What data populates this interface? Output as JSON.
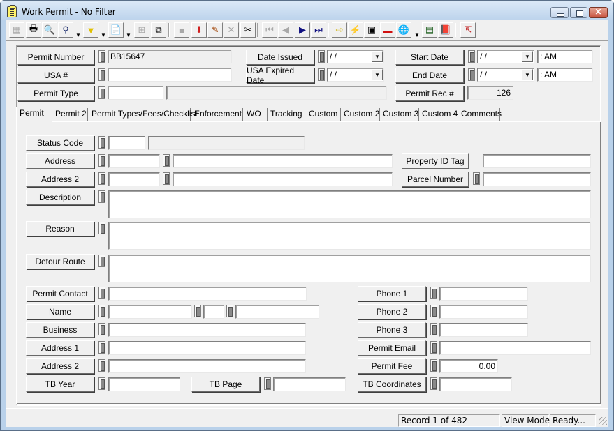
{
  "window": {
    "title": "Work Permit - No Filter"
  },
  "toolbar": {
    "buttons": [
      {
        "name": "form-view-icon",
        "glyph": "▦",
        "disabled": true
      },
      {
        "name": "print-icon",
        "glyph": "🖶"
      },
      {
        "name": "print-preview-icon",
        "glyph": "🔍"
      },
      {
        "name": "find-icon",
        "glyph": "⚲"
      },
      {
        "name": "filter-icon",
        "glyph": "▼"
      },
      {
        "name": "report-icon",
        "glyph": "📄"
      },
      {
        "name": "properties-icon",
        "glyph": "⊞",
        "disabled": true
      },
      {
        "name": "copy-record-icon",
        "glyph": "⧉"
      },
      {
        "name": "save-icon",
        "glyph": "■",
        "disabled": true
      },
      {
        "name": "import-icon",
        "glyph": "⬇"
      },
      {
        "name": "edit-icon",
        "glyph": "✎"
      },
      {
        "name": "delete-icon",
        "glyph": "✕",
        "disabled": true
      },
      {
        "name": "cut-icon",
        "glyph": "✂"
      },
      {
        "name": "first-record-icon",
        "glyph": "⏮",
        "disabled": true
      },
      {
        "name": "previous-record-icon",
        "glyph": "◀",
        "disabled": true
      },
      {
        "name": "next-record-icon",
        "glyph": "▶"
      },
      {
        "name": "last-record-icon",
        "glyph": "⏭"
      },
      {
        "name": "go-to-icon",
        "glyph": "⇨"
      },
      {
        "name": "quick-action-icon",
        "glyph": "⚡"
      },
      {
        "name": "workflow-icon",
        "glyph": "▣"
      },
      {
        "name": "toolbox-icon",
        "glyph": "▬"
      },
      {
        "name": "web-map-icon",
        "glyph": "🌐"
      },
      {
        "name": "calculator-icon",
        "glyph": "▤"
      },
      {
        "name": "help-book-icon",
        "glyph": "📕"
      },
      {
        "name": "exit-icon",
        "glyph": "⇱"
      }
    ]
  },
  "header": {
    "permit_number": {
      "label": "Permit Number",
      "value": "BB15647"
    },
    "usa_number": {
      "label": "USA #",
      "value": ""
    },
    "permit_type": {
      "label": "Permit Type",
      "code": "",
      "description": ""
    },
    "date_issued": {
      "label": "Date Issued",
      "value": " / /"
    },
    "usa_expired_date": {
      "label": "USA Expired Date",
      "value": " / /"
    },
    "start_date": {
      "label": "Start Date",
      "date": " / /",
      "time": "  :  AM"
    },
    "end_date": {
      "label": "End Date",
      "date": " / /",
      "time": "  :  AM"
    },
    "permit_rec": {
      "label": "Permit Rec #",
      "value": "126"
    }
  },
  "tabs": [
    {
      "label": "Permit",
      "active": true
    },
    {
      "label": "Permit 2"
    },
    {
      "label": "Permit Types/Fees/Checklist"
    },
    {
      "label": "Enforcement"
    },
    {
      "label": "WO"
    },
    {
      "label": "Tracking"
    },
    {
      "label": "Custom"
    },
    {
      "label": "Custom 2"
    },
    {
      "label": "Custom 3"
    },
    {
      "label": "Custom 4"
    },
    {
      "label": "Comments"
    }
  ],
  "permit_tab": {
    "status_code": {
      "label": "Status Code",
      "code": "",
      "description": ""
    },
    "address": {
      "label": "Address",
      "number": "",
      "street": ""
    },
    "address2": {
      "label": "Address 2",
      "number": "",
      "street": ""
    },
    "property_id_tag": {
      "label": "Property ID Tag",
      "value": ""
    },
    "parcel_number": {
      "label": "Parcel Number",
      "value": ""
    },
    "description": {
      "label": "Description",
      "value": ""
    },
    "reason": {
      "label": "Reason",
      "value": ""
    },
    "detour_route": {
      "label": "Detour Route",
      "value": ""
    },
    "permit_contact": {
      "label": "Permit Contact",
      "value": ""
    },
    "name": {
      "label": "Name",
      "first": "",
      "middle": "",
      "last": ""
    },
    "business": {
      "label": "Business",
      "value": ""
    },
    "address1_contact": {
      "label": "Address 1",
      "value": ""
    },
    "address2_contact": {
      "label": "Address 2",
      "value": ""
    },
    "tb_year": {
      "label": "TB Year",
      "value": ""
    },
    "tb_page": {
      "label": "TB Page",
      "value": ""
    },
    "phone1": {
      "label": "Phone 1",
      "value": ""
    },
    "phone2": {
      "label": "Phone 2",
      "value": ""
    },
    "phone3": {
      "label": "Phone 3",
      "value": ""
    },
    "permit_email": {
      "label": "Permit Email",
      "value": ""
    },
    "permit_fee": {
      "label": "Permit Fee",
      "value": "0.00"
    },
    "tb_coordinates": {
      "label": "TB Coordinates",
      "value": ""
    }
  },
  "statusbar": {
    "record": "Record 1 of 482",
    "mode": "View Mode",
    "state": "Ready..."
  }
}
